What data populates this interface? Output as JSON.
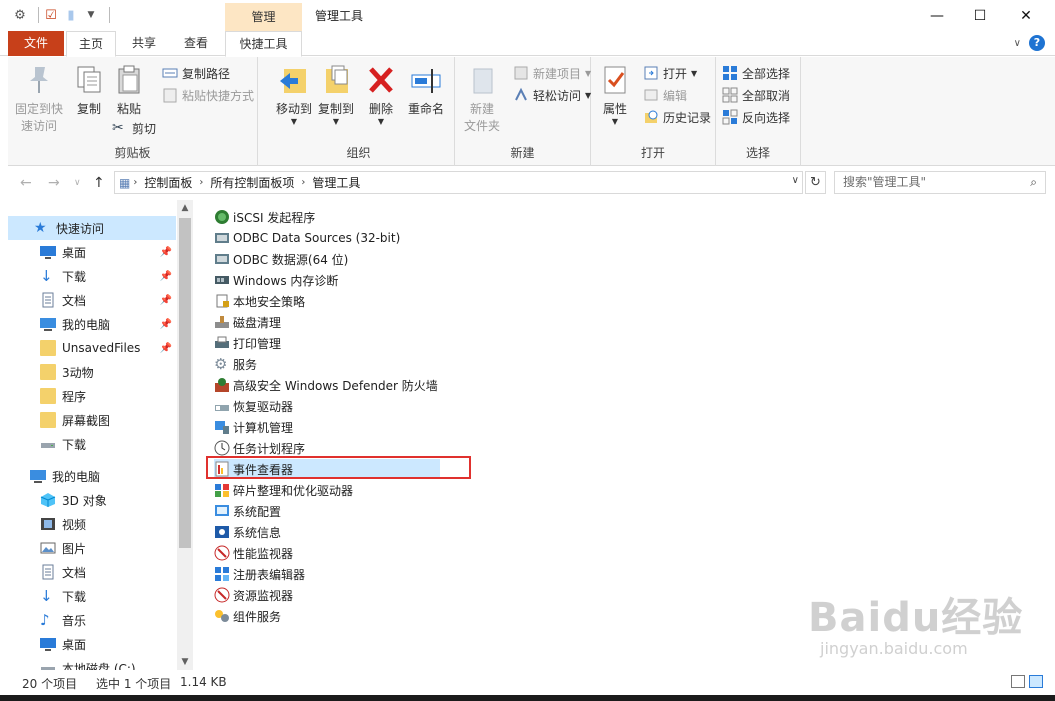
{
  "titlebar": {
    "context_tab_head": "管理",
    "window_title": "管理工具",
    "minimize": "—",
    "maximize": "☐",
    "close": "✕"
  },
  "tabs": {
    "file": "文件",
    "home": "主页",
    "share": "共享",
    "view": "查看",
    "tools": "快捷工具"
  },
  "ribbon": {
    "clipboard": {
      "label": "剪贴板",
      "pin": "固定到快\n速访问",
      "pin_line1": "固定到快",
      "pin_line2": "速访问",
      "copy": "复制",
      "paste": "粘贴",
      "copy_path": "复制路径",
      "paste_shortcut": "粘贴快捷方式",
      "cut": "剪切"
    },
    "organize": {
      "label": "组织",
      "move_to": "移动到",
      "copy_to": "复制到",
      "delete": "删除",
      "rename": "重命名"
    },
    "new": {
      "label": "新建",
      "new_folder_line1": "新建",
      "new_folder_line2": "文件夹",
      "new_item": "新建项目",
      "easy_access": "轻松访问"
    },
    "open": {
      "label": "打开",
      "properties": "属性",
      "open": "打开",
      "edit": "编辑",
      "history": "历史记录"
    },
    "select": {
      "label": "选择",
      "select_all": "全部选择",
      "select_none": "全部取消",
      "invert": "反向选择"
    }
  },
  "address": {
    "segments": [
      "控制面板",
      "所有控制面板项",
      "管理工具"
    ],
    "search_placeholder": "搜索\"管理工具\""
  },
  "navpane": {
    "items": [
      {
        "label": "快速访问",
        "icon": "star-icon"
      },
      {
        "label": "桌面",
        "icon": "desktop-icon"
      },
      {
        "label": "下载",
        "icon": "download-icon"
      },
      {
        "label": "文档",
        "icon": "document-icon"
      },
      {
        "label": "我的电脑",
        "icon": "computer-icon"
      },
      {
        "label": "UnsavedFiles",
        "icon": "folder-icon"
      },
      {
        "label": "3动物",
        "icon": "folder-icon"
      },
      {
        "label": "程序",
        "icon": "folder-icon"
      },
      {
        "label": "屏幕截图",
        "icon": "folder-icon"
      },
      {
        "label": "下载",
        "icon": "drive-icon"
      },
      {
        "label": "我的电脑",
        "icon": "computer-icon"
      },
      {
        "label": "3D 对象",
        "icon": "cube-icon"
      },
      {
        "label": "视频",
        "icon": "video-icon"
      },
      {
        "label": "图片",
        "icon": "picture-icon"
      },
      {
        "label": "文档",
        "icon": "document-icon"
      },
      {
        "label": "下载",
        "icon": "download-icon"
      },
      {
        "label": "音乐",
        "icon": "music-icon"
      },
      {
        "label": "桌面",
        "icon": "desktop-icon"
      },
      {
        "label": "本地磁盘 (C:)",
        "icon": "drive-icon"
      }
    ]
  },
  "files": [
    "iSCSI 发起程序",
    "ODBC Data Sources (32-bit)",
    "ODBC 数据源(64 位)",
    "Windows 内存诊断",
    "本地安全策略",
    "磁盘清理",
    "打印管理",
    "服务",
    "高级安全 Windows Defender 防火墙",
    "恢复驱动器",
    "计算机管理",
    "任务计划程序",
    "事件查看器",
    "碎片整理和优化驱动器",
    "系统配置",
    "系统信息",
    "性能监视器",
    "注册表编辑器",
    "资源监视器",
    "组件服务"
  ],
  "status": {
    "count": "20 个项目",
    "selection": "选中 1 个项目",
    "size": "1.14 KB"
  },
  "watermark": {
    "big": "Baidu经验",
    "small": "jingyan.baidu.com"
  },
  "colors": {
    "file_tab": "#c7401a",
    "context_tab": "#fde6c4",
    "selection": "#cce8ff",
    "highlight_border": "#e0312e"
  }
}
